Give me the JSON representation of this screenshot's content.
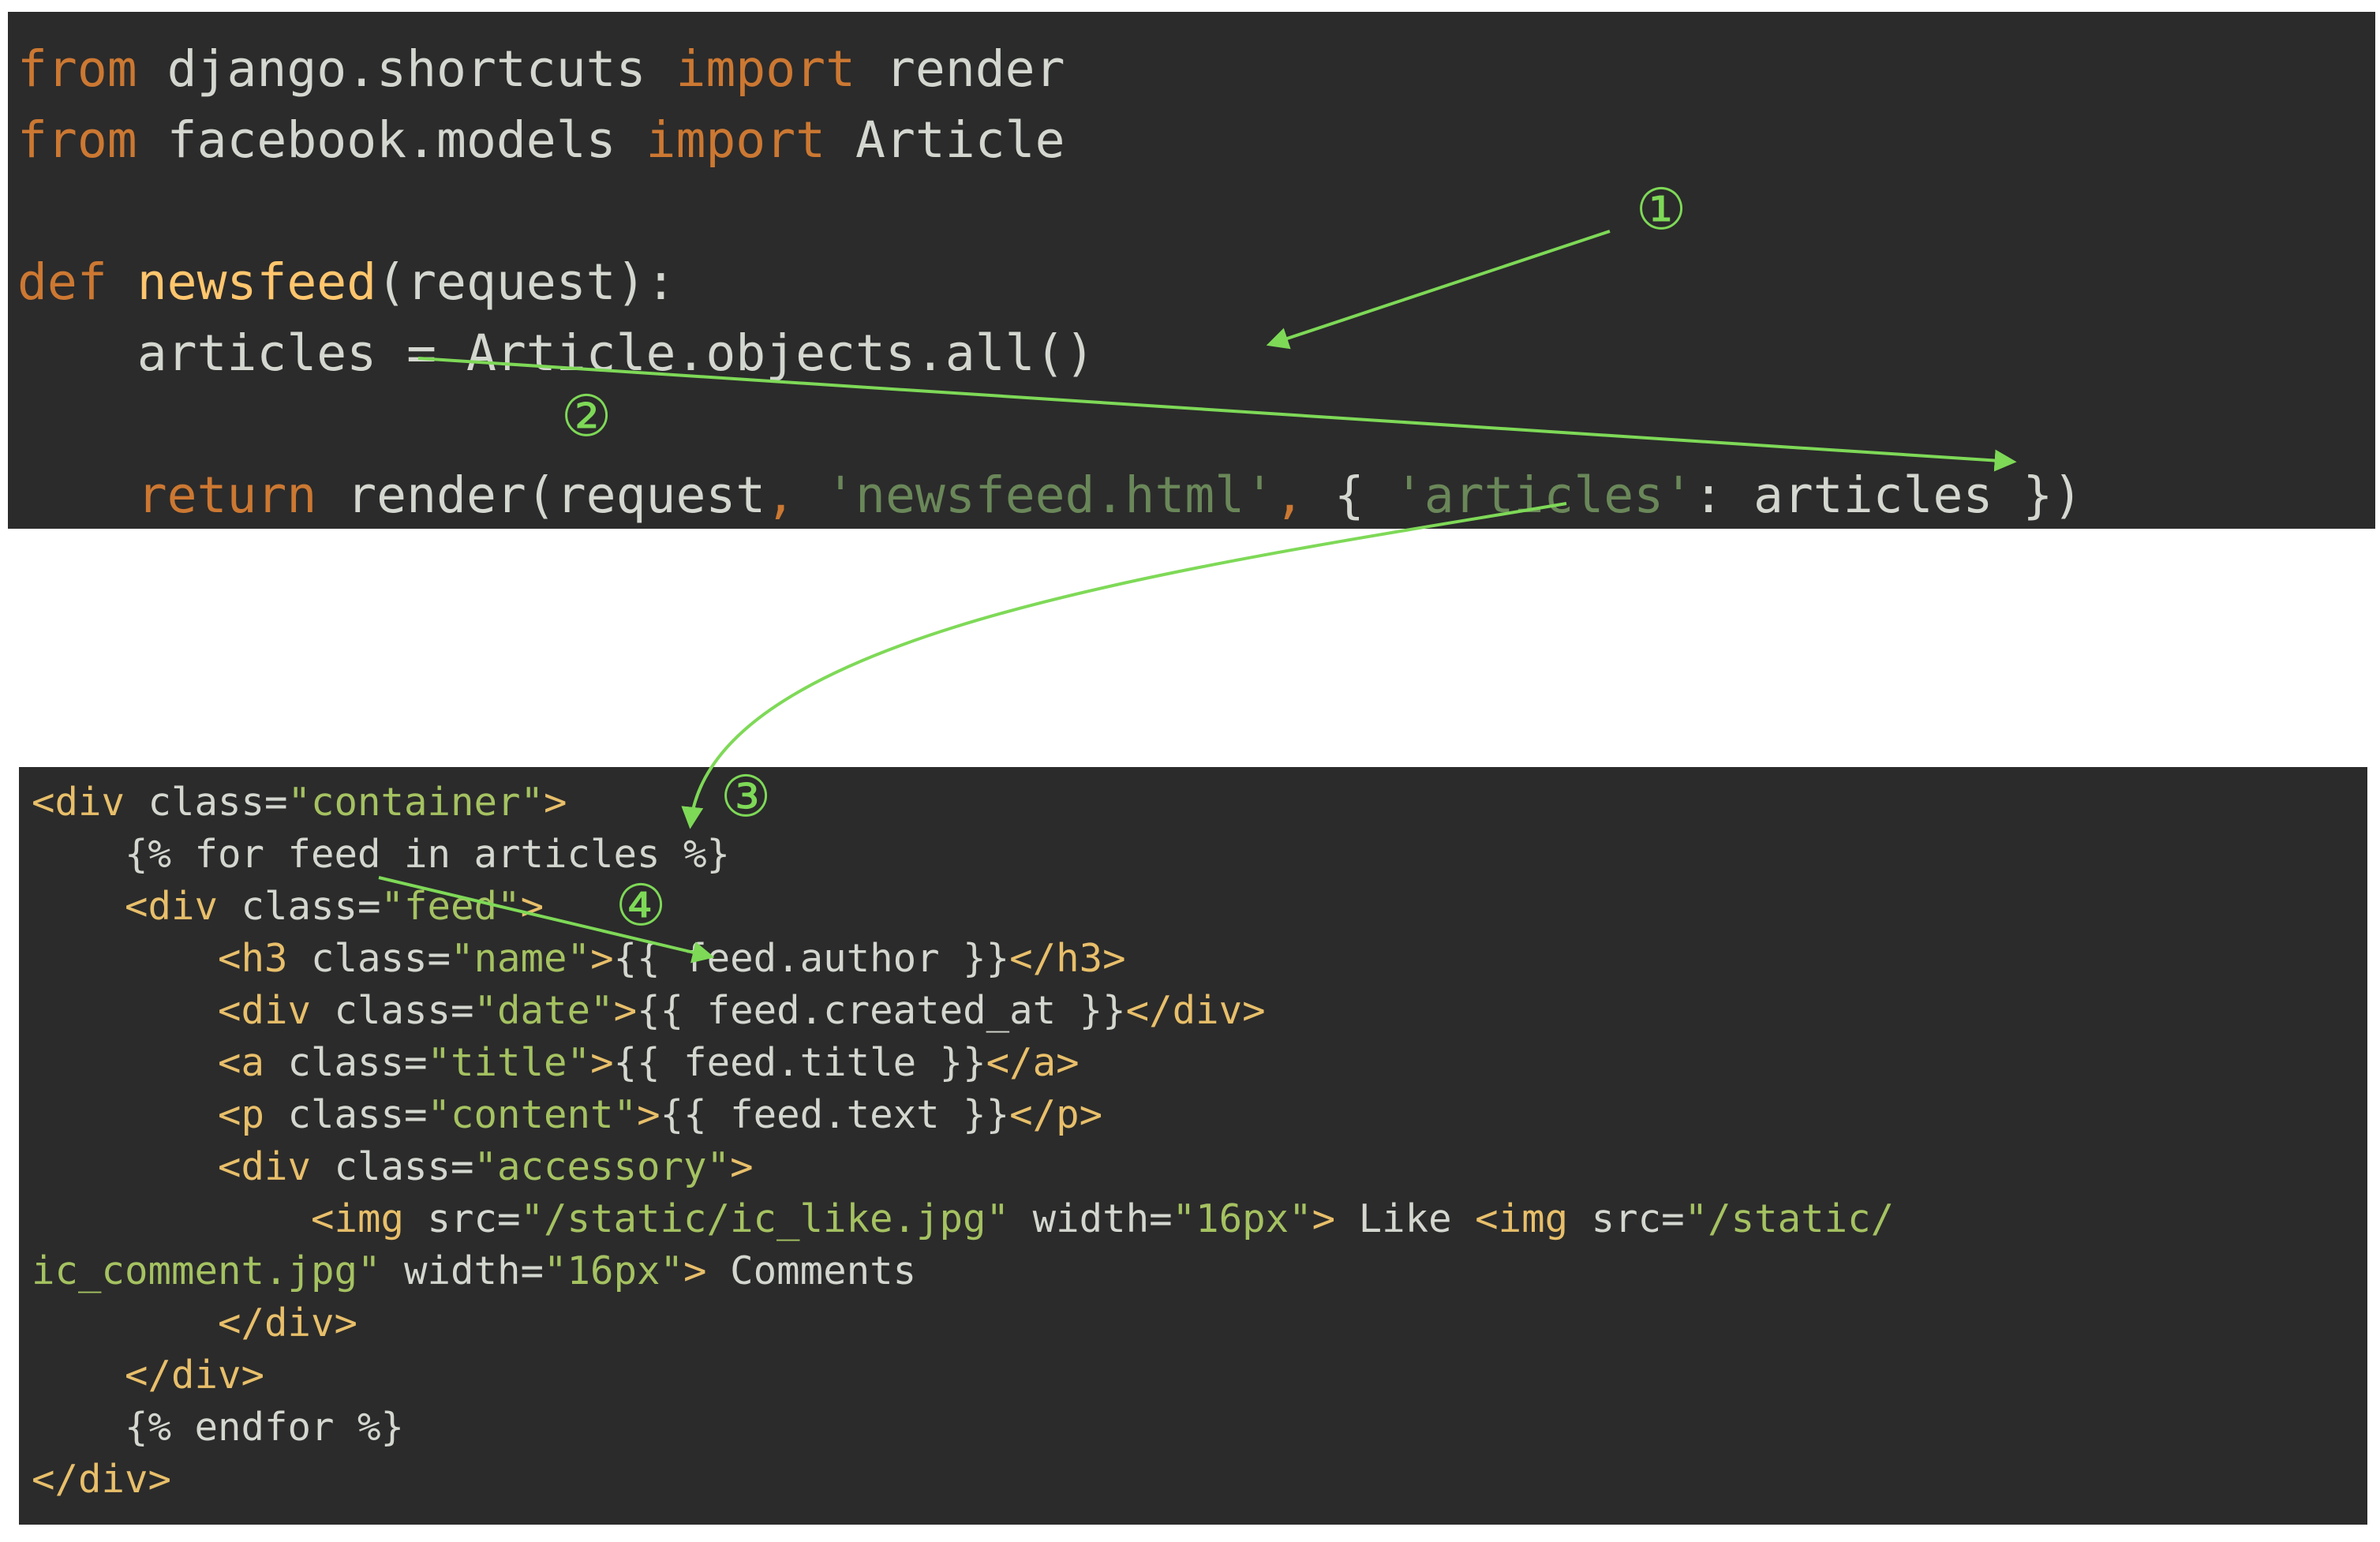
{
  "python_code": {
    "line1": {
      "kw1": "from",
      "mod": " django.shortcuts ",
      "kw2": "import",
      "name": " render"
    },
    "line2": {
      "kw1": "from",
      "mod": " facebook.models ",
      "kw2": "import",
      "name": " Article"
    },
    "line3": {
      "kw": "def",
      "fn": " newsfeed",
      "args": "(request):"
    },
    "line4": {
      "code": "    articles = Article.objects.all()"
    },
    "line5": {
      "indent": "    ",
      "kw": "return",
      "call": " render(request",
      "comma1": ",",
      "str1": " 'newsfeed.html'",
      "comma2": ",",
      "brace_open": " {",
      "str2": " 'articles'",
      "rest": ": articles })"
    }
  },
  "template_code": {
    "l1": {
      "tag_open": "<div",
      "attr": " class=",
      "val": "\"container\"",
      "tag_close": ">"
    },
    "l2": {
      "text": "    {% for feed in articles %}"
    },
    "l3": {
      "indent": "    ",
      "tag_open": "<div",
      "attr": " class=",
      "val": "\"feed\"",
      "tag_close": ">"
    },
    "l4": {
      "indent": "        ",
      "tag_open": "<h3",
      "attr": " class=",
      "val": "\"name\"",
      "tag_close": ">",
      "expr": "{{ feed.author }}",
      "end": "</h3>"
    },
    "l5": {
      "indent": "        ",
      "tag_open": "<div",
      "attr": " class=",
      "val": "\"date\"",
      "tag_close": ">",
      "expr": "{{ feed.created_at }}",
      "end": "</div>"
    },
    "l6": {
      "indent": "        ",
      "tag_open": "<a",
      "attr": " class=",
      "val": "\"title\"",
      "tag_close": ">",
      "expr": "{{ feed.title }}",
      "end": "</a>"
    },
    "l7": {
      "indent": "        ",
      "tag_open": "<p",
      "attr": " class=",
      "val": "\"content\"",
      "tag_close": ">",
      "expr": "{{ feed.text }}",
      "end": "</p>"
    },
    "l8": {
      "indent": "        ",
      "tag_open": "<div",
      "attr": " class=",
      "val": "\"accessory\"",
      "tag_close": ">"
    },
    "l9": {
      "indent": "            ",
      "tag1": "<img",
      "attr1": " src=",
      "val1": "\"/static/ic_like.jpg\"",
      "attr2": " width=",
      "val2": "\"16px\"",
      "tag1_close": ">",
      "text": " Like ",
      "tag2": "<img",
      "attr3": " src=",
      "val3": "\"/static/"
    },
    "l10": {
      "val3b": "ic_comment.jpg\"",
      "attr4": " width=",
      "val4": "\"16px\"",
      "tag2_close": ">",
      "text": " Comments"
    },
    "l11": {
      "indent": "        ",
      "tag": "</div>"
    },
    "l12": {
      "indent": "    ",
      "tag": "</div>"
    },
    "l13": {
      "text": "    {% endfor %}"
    },
    "l14": {
      "tag": "</div>"
    }
  },
  "annotations": {
    "marker1": "①",
    "marker2": "②",
    "marker3": "③",
    "marker4": "④",
    "arrow_color": "#7ed957"
  }
}
